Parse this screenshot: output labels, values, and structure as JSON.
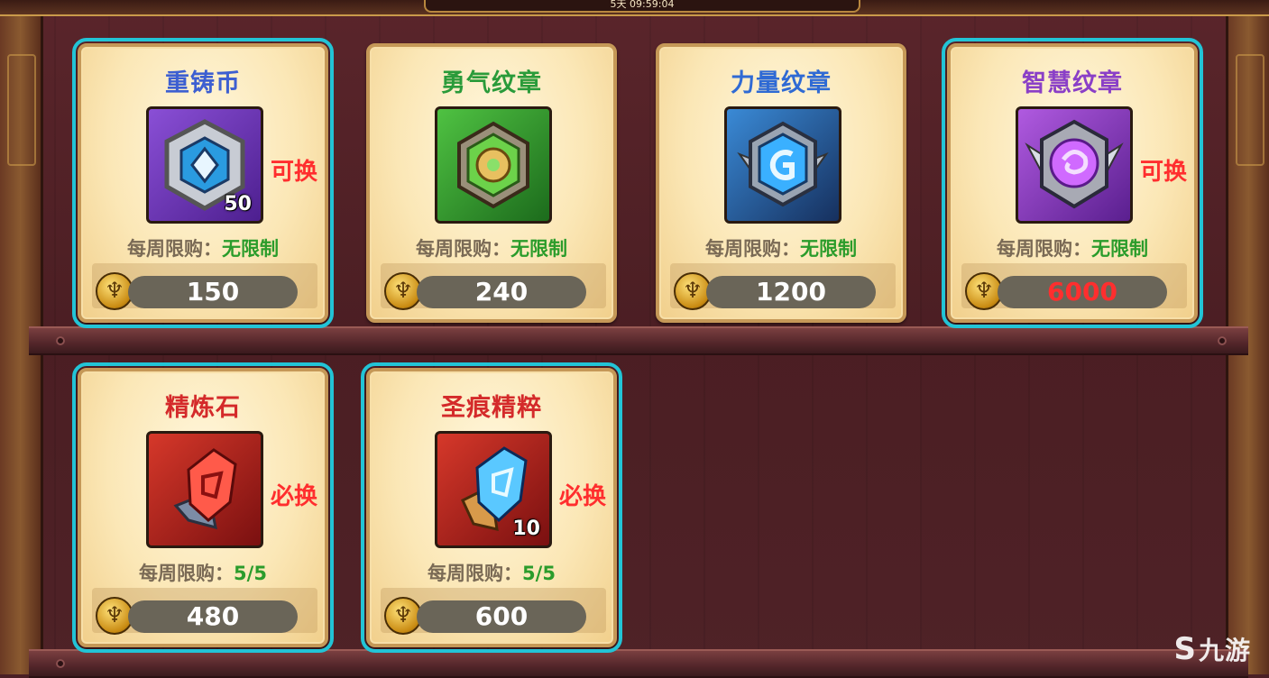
{
  "header": {
    "timer": "5天 09:59:04"
  },
  "items": [
    {
      "id": "chongzhu",
      "title": "重铸币",
      "title_color": "#3d5fd1",
      "count": "50",
      "tag": "可换",
      "limit_label": "每周限购：",
      "limit_value": "无限制",
      "price": "150",
      "price_red": false,
      "icon": "reforge-coin-icon",
      "highlighted": true
    },
    {
      "id": "yongqi",
      "title": "勇气纹章",
      "title_color": "#2a9b3a",
      "count": "",
      "tag": "",
      "limit_label": "每周限购：",
      "limit_value": "无限制",
      "price": "240",
      "price_red": false,
      "icon": "courage-emblem-icon",
      "highlighted": false
    },
    {
      "id": "liliang",
      "title": "力量纹章",
      "title_color": "#2f6ad4",
      "count": "",
      "tag": "",
      "limit_label": "每周限购：",
      "limit_value": "无限制",
      "price": "1200",
      "price_red": false,
      "icon": "power-emblem-icon",
      "highlighted": false
    },
    {
      "id": "zhihui",
      "title": "智慧纹章",
      "title_color": "#8a3fc7",
      "count": "",
      "tag": "可换",
      "limit_label": "每周限购：",
      "limit_value": "无限制",
      "price": "6000",
      "price_red": true,
      "icon": "wisdom-emblem-icon",
      "highlighted": true
    },
    {
      "id": "jinglian",
      "title": "精炼石",
      "title_color": "#d42a2a",
      "count": "",
      "tag": "必换",
      "limit_label": "每周限购：",
      "limit_value": "5/5",
      "price": "480",
      "price_red": false,
      "icon": "refining-stone-icon",
      "highlighted": true
    },
    {
      "id": "shenghen",
      "title": "圣痕精粹",
      "title_color": "#d42a2a",
      "count": "10",
      "tag": "必换",
      "limit_label": "每周限购：",
      "limit_value": "5/5",
      "price": "600",
      "price_red": false,
      "icon": "stigmata-essence-icon",
      "highlighted": true
    }
  ],
  "watermark": {
    "text": "九游"
  }
}
